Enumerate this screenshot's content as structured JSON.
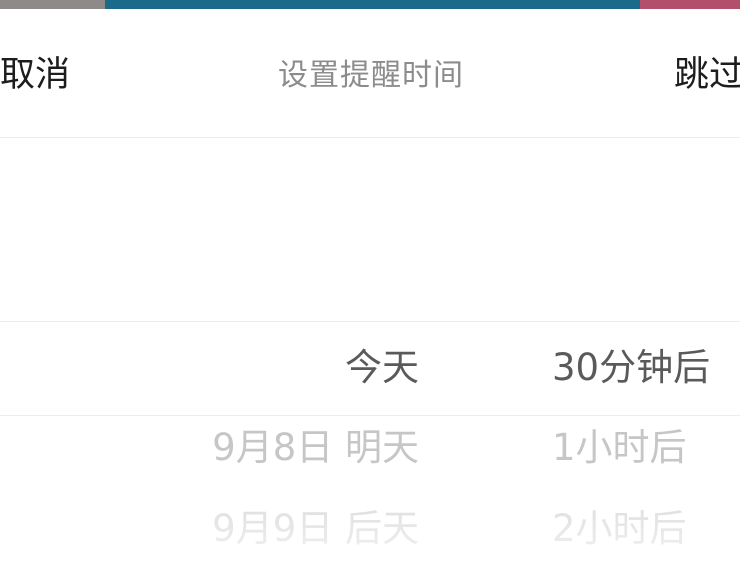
{
  "header": {
    "cancel_label": "取消",
    "title": "设置提醒时间",
    "skip_label": "跳过"
  },
  "picker": {
    "selected_index": 0,
    "day_options": [
      "今天",
      "9月8日 明天",
      "9月9日 后天"
    ],
    "offset_options": [
      "30分钟后",
      "1小时后",
      "2小时后"
    ]
  },
  "colors": {
    "selected_text": "#5a5a5a",
    "unselected_text": "#c6c6c6",
    "divider": "#ececec"
  }
}
